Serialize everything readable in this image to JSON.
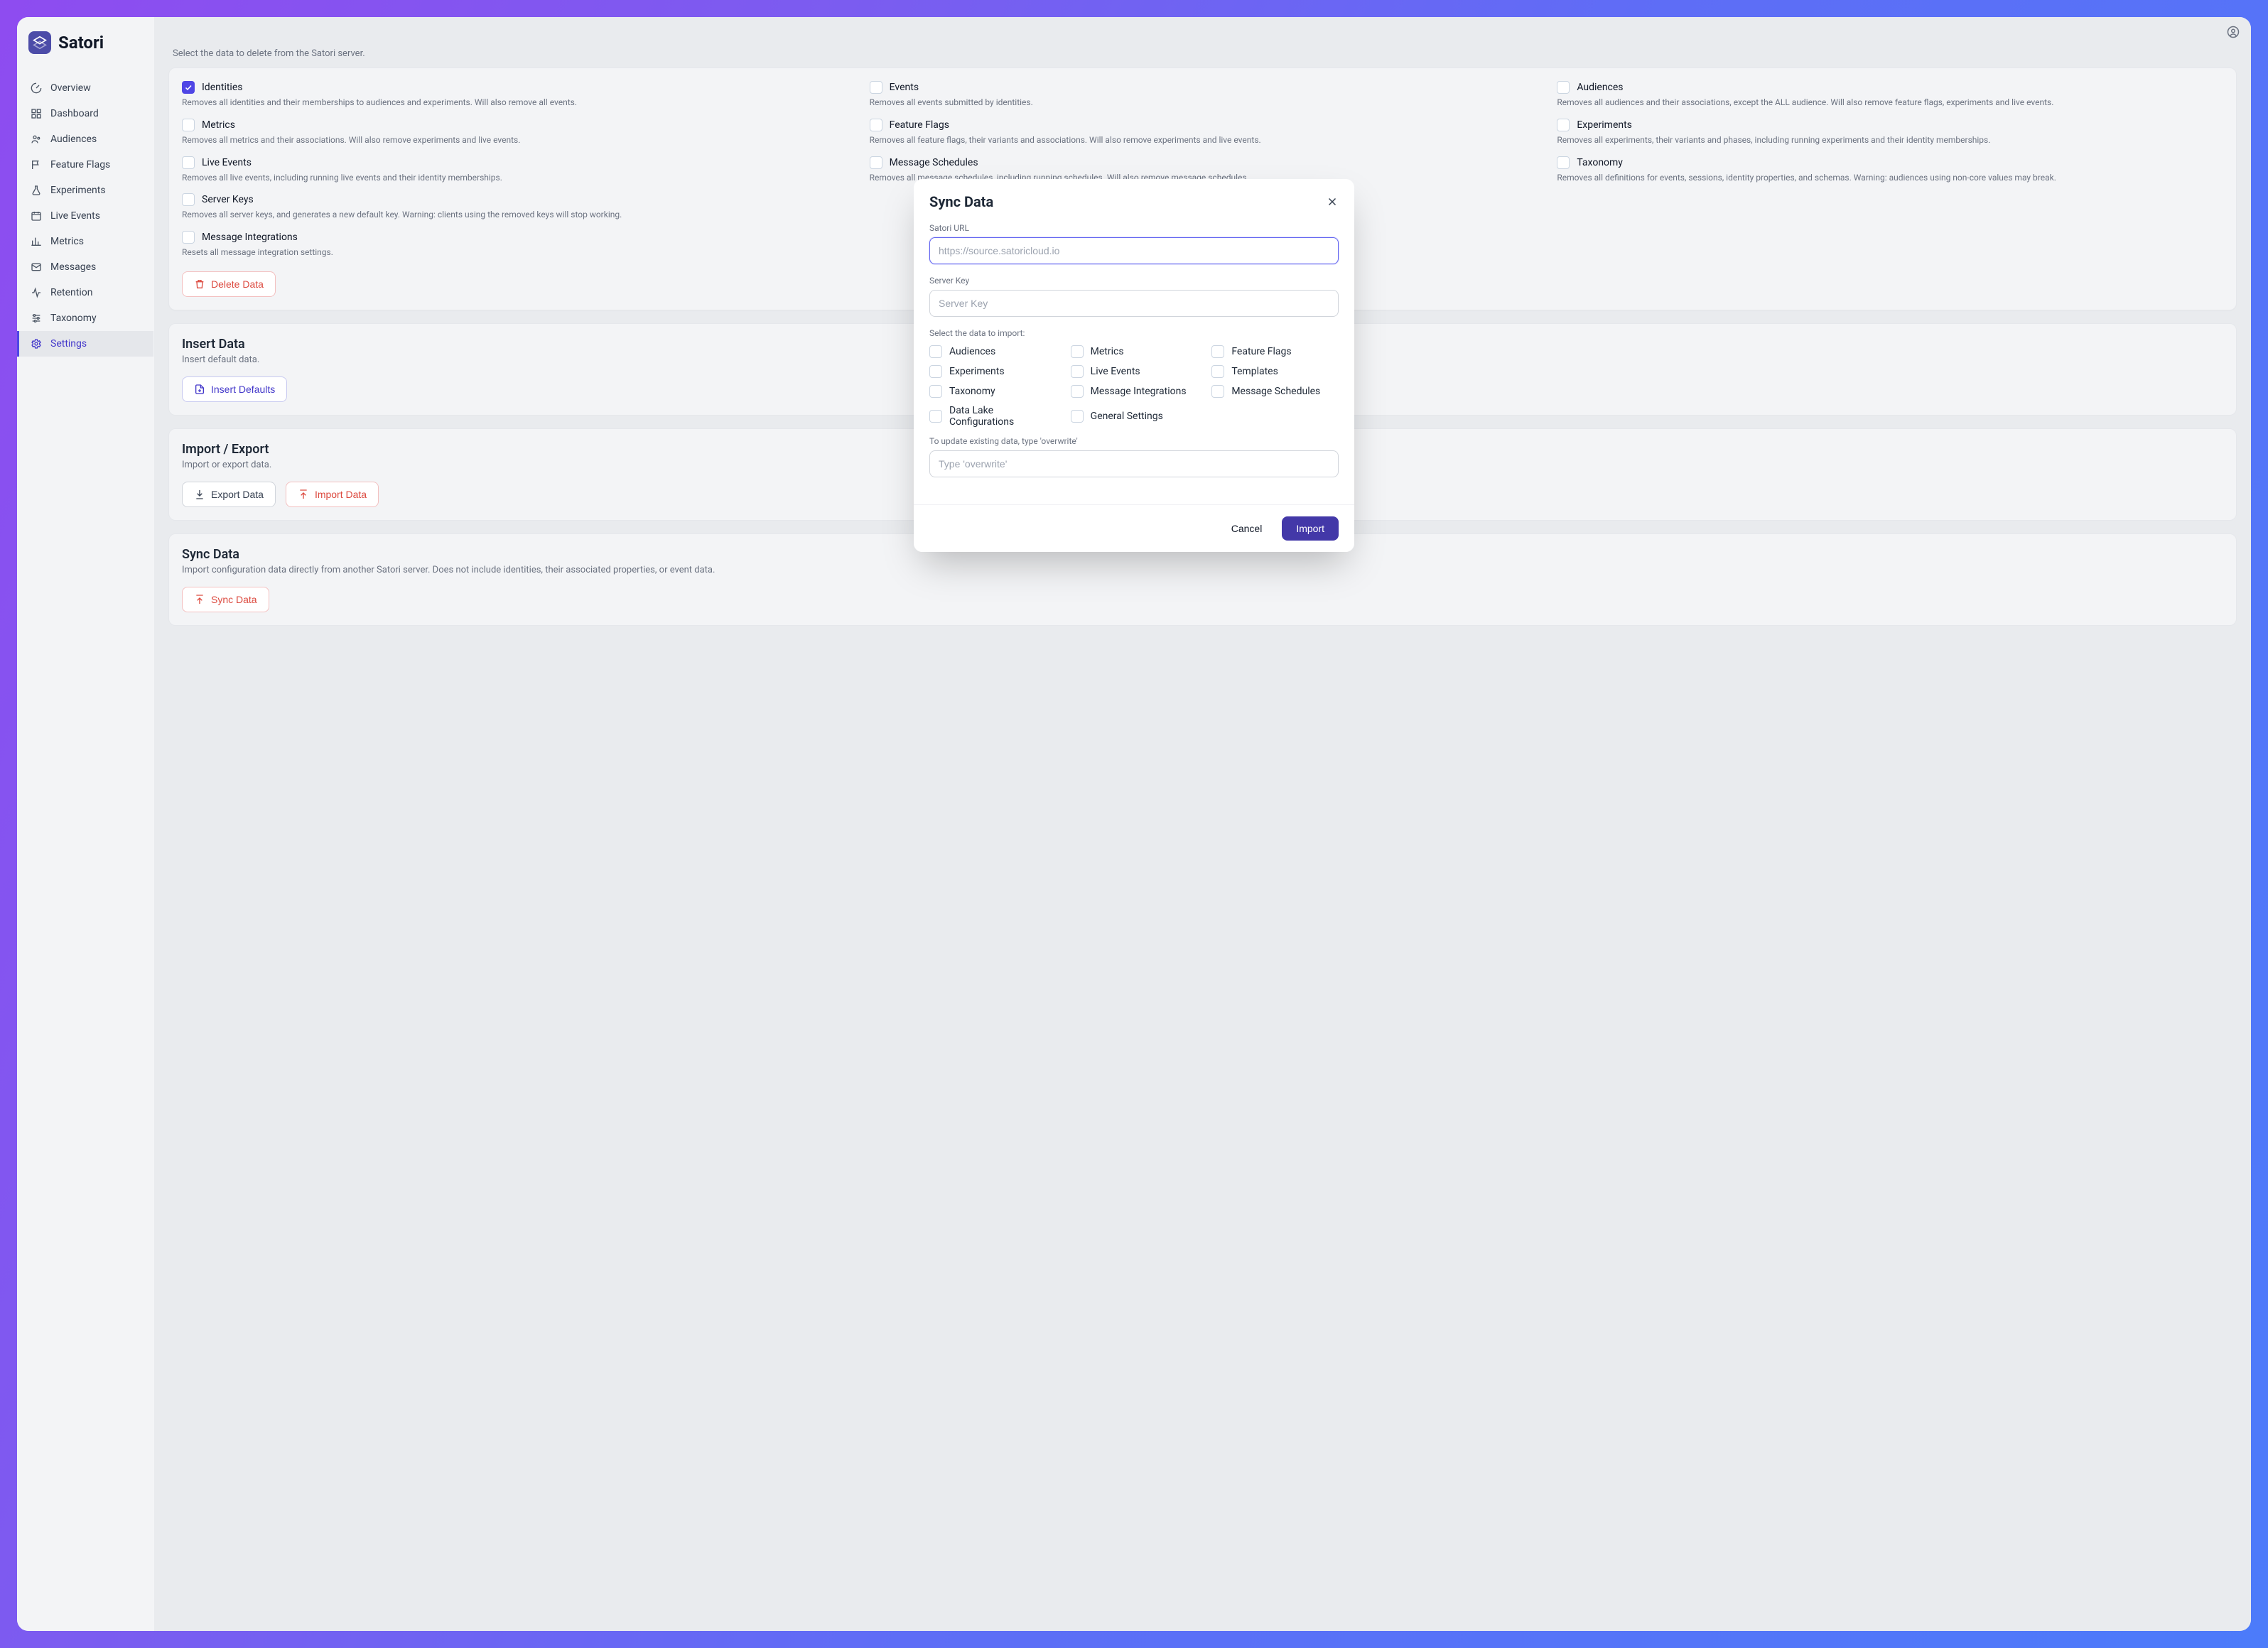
{
  "brand": {
    "name": "Satori"
  },
  "nav": {
    "overview": "Overview",
    "dashboard": "Dashboard",
    "audiences": "Audiences",
    "feature_flags": "Feature Flags",
    "experiments": "Experiments",
    "live_events": "Live Events",
    "metrics": "Metrics",
    "messages": "Messages",
    "retention": "Retention",
    "taxonomy": "Taxonomy",
    "settings": "Settings"
  },
  "page": {
    "select_delete_desc": "Select the data to delete from the Satori server."
  },
  "delete_opts": {
    "identities": {
      "title": "Identities",
      "desc": "Removes all identities and their memberships to audiences and experiments. Will also remove all events."
    },
    "events": {
      "title": "Events",
      "desc": "Removes all events submitted by identities."
    },
    "audiences": {
      "title": "Audiences",
      "desc": "Removes all audiences and their associations, except the ALL audience. Will also remove feature flags, experiments and live events."
    },
    "metrics": {
      "title": "Metrics",
      "desc": "Removes all metrics and their associations. Will also remove experiments and live events."
    },
    "feature_flags": {
      "title": "Feature Flags",
      "desc": "Removes all feature flags, their variants and associations. Will also remove experiments and live events."
    },
    "experiments": {
      "title": "Experiments",
      "desc": "Removes all experiments, their variants and phases, including running experiments and their identity memberships."
    },
    "live_events": {
      "title": "Live Events",
      "desc": "Removes all live events, including running live events and their identity memberships."
    },
    "message_schedules": {
      "title": "Message Schedules",
      "desc": "Removes all message schedules, including running schedules. Will also remove message schedules."
    },
    "taxonomy": {
      "title": "Taxonomy",
      "desc": "Removes all definitions for events, sessions, identity properties, and schemas. Warning: audiences using non-core values may break."
    },
    "server_keys": {
      "title": "Server Keys",
      "desc": "Removes all server keys, and generates a new default key. Warning: clients using the removed keys will stop working."
    },
    "message_integrations": {
      "title": "Message Integrations",
      "desc": "Resets all message integration settings."
    }
  },
  "buttons": {
    "delete_data": "Delete Data",
    "insert_defaults": "Insert Defaults",
    "export_data": "Export Data",
    "import_data": "Import Data",
    "sync_data": "Sync Data"
  },
  "sections": {
    "insert": {
      "title": "Insert Data",
      "sub": "Insert default data."
    },
    "impexp": {
      "title": "Import / Export",
      "sub": "Import or export data."
    },
    "sync": {
      "title": "Sync Data",
      "sub": "Import configuration data directly from another Satori server. Does not include identities, their associated properties, or event data."
    }
  },
  "modal": {
    "title": "Sync Data",
    "url_label": "Satori URL",
    "url_placeholder": "https://source.satoricloud.io",
    "key_label": "Server Key",
    "key_placeholder": "Server Key",
    "select_label": "Select the data to import:",
    "opts": {
      "audiences": "Audiences",
      "metrics": "Metrics",
      "feature_flags": "Feature Flags",
      "experiments": "Experiments",
      "live_events": "Live Events",
      "templates": "Templates",
      "taxonomy": "Taxonomy",
      "message_integrations": "Message Integrations",
      "message_schedules": "Message Schedules",
      "data_lake": "Data Lake Configurations",
      "general_settings": "General Settings"
    },
    "overwrite_label": "To update existing data, type 'overwrite'",
    "overwrite_placeholder": "Type 'overwrite'",
    "cancel": "Cancel",
    "import": "Import"
  }
}
